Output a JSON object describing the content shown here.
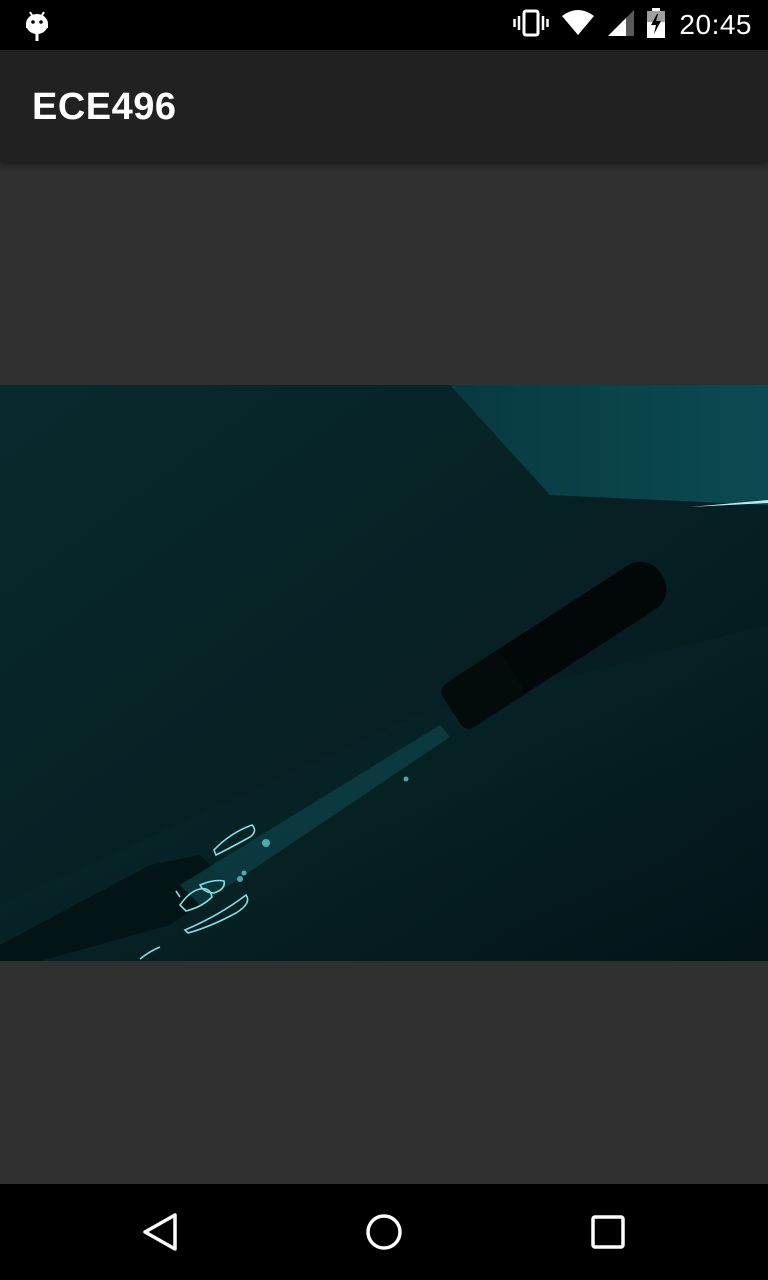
{
  "status_bar": {
    "time": "20:45",
    "icons": [
      "android-debug-icon",
      "vibrate-icon",
      "wifi-icon",
      "cell-signal-icon",
      "battery-charging-icon"
    ]
  },
  "app_bar": {
    "title": "ECE496"
  },
  "content": {
    "camera_preview": {
      "description_icon": "camera-preview",
      "tint_color": "#0b3e44"
    }
  },
  "nav_bar": {
    "buttons": [
      "back-icon",
      "home-icon",
      "recents-icon"
    ]
  },
  "colors": {
    "status_bar_bg": "#000000",
    "app_bar_bg": "#212121",
    "content_bg": "#303030",
    "nav_bar_bg": "#000000",
    "edge_highlight": "#7fe0e8"
  }
}
